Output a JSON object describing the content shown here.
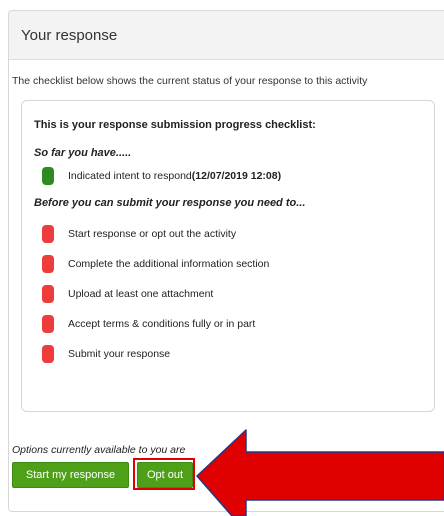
{
  "panel": {
    "title": "Your response",
    "intro": "The checklist below shows the current status of your response to this activity"
  },
  "checklist": {
    "title": "This is your response submission progress checklist:",
    "done_label": "So far you have.....",
    "done_items": [
      {
        "text": "Indicated intent to respond ",
        "date": "(12/07/2019 12:08)",
        "status": "complete",
        "color": "#2e8b1f"
      }
    ],
    "todo_label": "Before you can submit your response you need to...",
    "todo_items": [
      {
        "text": "Start response or opt out the activity",
        "status": "incomplete",
        "color": "#ee3b3b"
      },
      {
        "text": "Complete the additional information section",
        "status": "incomplete",
        "color": "#ee3b3b"
      },
      {
        "text": "Upload at least one attachment",
        "status": "incomplete",
        "color": "#ee3b3b"
      },
      {
        "text": "Accept terms & conditions fully or in part",
        "status": "incomplete",
        "color": "#ee3b3b"
      },
      {
        "text": "Submit your response",
        "status": "incomplete",
        "color": "#ee3b3b"
      }
    ]
  },
  "options": {
    "label": "Options currently available to you are",
    "start_button": "Start my response",
    "opt_out_button": "Opt out"
  },
  "colors": {
    "button_green": "#4ea019",
    "annotation_arrow": "#e00000",
    "annotation_outline": "#1e3a8a"
  },
  "icons": {
    "annotation": "red-arrow-pointing-left"
  }
}
